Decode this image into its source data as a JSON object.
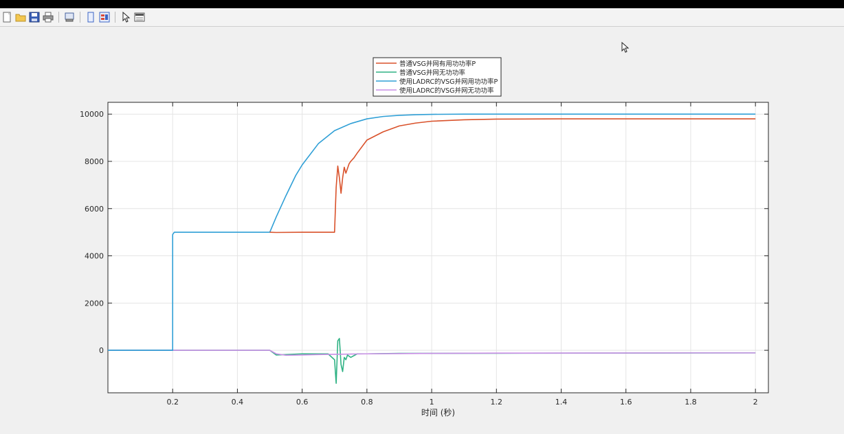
{
  "window": {
    "title": ""
  },
  "toolbar": {
    "buttons": [
      {
        "icon": "new-figure-icon"
      },
      {
        "icon": "open-folder-icon"
      },
      {
        "icon": "save-icon"
      },
      {
        "icon": "print-icon"
      },
      {
        "icon": "print-preview-icon"
      },
      {
        "icon": "hide-plot-tools-icon"
      },
      {
        "icon": "show-plot-tools-icon"
      },
      {
        "icon": "edit-plot-arrow-icon"
      },
      {
        "icon": "insert-colorbar-icon"
      }
    ]
  },
  "colors": {
    "red": "#d9512a",
    "green": "#2fb284",
    "blue": "#2f9fd6",
    "purple": "#c98ee6",
    "purple_dark": "#8f6dd6",
    "axes_bg": "#ffffff",
    "grid": "#e4e4e4"
  },
  "chart_data": {
    "type": "line",
    "title": "",
    "xlabel": "时间 (秒)",
    "ylabel": "",
    "xlim": [
      0,
      2.04
    ],
    "ylim": [
      -1800,
      10500
    ],
    "xticks": [
      0.2,
      0.4,
      0.6,
      0.8,
      1,
      1.2,
      1.4,
      1.6,
      1.8,
      2
    ],
    "xtick_labels": [
      "0.2",
      "0.4",
      "0.6",
      "0.8",
      "1",
      "1.2",
      "1.4",
      "1.6",
      "1.8",
      "2"
    ],
    "yticks": [
      0,
      2000,
      4000,
      6000,
      8000,
      10000
    ],
    "ytick_labels": [
      "0",
      "2000",
      "4000",
      "6000",
      "8000",
      "10000"
    ],
    "grid": true,
    "legend_position": "top",
    "series": [
      {
        "name": "普通VSG并网有用功功率P",
        "color": "#d9512a",
        "x": [
          0.5,
          0.52,
          0.6,
          0.7,
          0.705,
          0.71,
          0.715,
          0.72,
          0.725,
          0.73,
          0.735,
          0.74,
          0.745,
          0.75,
          0.76,
          0.77,
          0.8,
          0.85,
          0.9,
          0.95,
          1.0,
          1.1,
          1.2,
          1.4,
          1.6,
          1.8,
          2.0
        ],
        "y": [
          5000,
          4990,
          5000,
          5000,
          6900,
          7800,
          7300,
          6650,
          7300,
          7750,
          7500,
          7700,
          7900,
          8000,
          8150,
          8350,
          8900,
          9250,
          9500,
          9620,
          9700,
          9760,
          9790,
          9800,
          9800,
          9800,
          9800
        ]
      },
      {
        "name": "普通VSG并网无功功率",
        "color": "#2fb284",
        "x": [
          0,
          0.5,
          0.52,
          0.6,
          0.68,
          0.7,
          0.705,
          0.71,
          0.715,
          0.72,
          0.725,
          0.73,
          0.735,
          0.74,
          0.75,
          0.77,
          0.8,
          0.9,
          1.0,
          1.2,
          1.5,
          2.0
        ],
        "y": [
          0,
          0,
          -200,
          -150,
          -150,
          -400,
          -1400,
          400,
          500,
          -600,
          -900,
          -300,
          -400,
          -200,
          -300,
          -150,
          -150,
          -130,
          -130,
          -125,
          -120,
          -110
        ]
      },
      {
        "name": "使用LADRC的VSG并网用功功率P",
        "color": "#2f9fd6",
        "x": [
          0,
          0.2,
          0.2,
          0.205,
          0.25,
          0.3,
          0.4,
          0.5,
          0.52,
          0.55,
          0.58,
          0.6,
          0.65,
          0.7,
          0.75,
          0.8,
          0.85,
          0.9,
          0.95,
          1.0,
          1.1,
          1.2,
          1.4,
          1.6,
          1.8,
          2.0
        ],
        "y": [
          0,
          0,
          4900,
          5000,
          5000,
          5000,
          5000,
          5000,
          5650,
          6550,
          7400,
          7850,
          8750,
          9300,
          9600,
          9800,
          9900,
          9950,
          9975,
          9990,
          10000,
          10000,
          10000,
          10000,
          10000,
          10000
        ]
      },
      {
        "name": "使用LADRC的VSG并网无功功率",
        "color": "#c98ee6",
        "x": [
          0,
          0.5,
          0.52,
          0.55,
          0.6,
          0.65,
          0.7,
          0.75,
          0.8,
          0.9,
          1.0,
          1.2,
          1.5,
          1.8,
          2.0
        ],
        "y": [
          0,
          0,
          -150,
          -210,
          -200,
          -180,
          -170,
          -160,
          -150,
          -140,
          -130,
          -120,
          -115,
          -110,
          -110
        ]
      }
    ]
  }
}
